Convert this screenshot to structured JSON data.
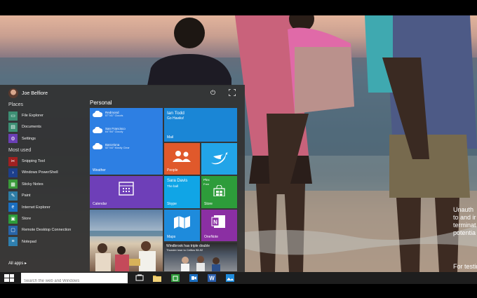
{
  "user": {
    "name": "Joe Belfiore"
  },
  "left": {
    "places_label": "Places",
    "places": [
      {
        "label": "File Explorer",
        "icon": "folder-icon",
        "color": "#3d8f74"
      },
      {
        "label": "Documents",
        "icon": "documents-icon",
        "color": "#3d8f74"
      },
      {
        "label": "Settings",
        "icon": "gear-icon",
        "color": "#6a3fb5"
      }
    ],
    "most_used_label": "Most used",
    "most_used": [
      {
        "label": "Snipping Tool",
        "icon": "scissors-icon",
        "color": "#a02020"
      },
      {
        "label": "Windows PowerShell",
        "icon": "powershell-icon",
        "color": "#1d3f8c"
      },
      {
        "label": "Sticky Notes",
        "icon": "sticky-notes-icon",
        "color": "#3a9a3a"
      },
      {
        "label": "Paint",
        "icon": "paint-icon",
        "color": "#2e7da6"
      },
      {
        "label": "Internet Explorer",
        "icon": "internet-explorer-icon",
        "color": "#1a6ec0"
      },
      {
        "label": "Store",
        "icon": "store-icon",
        "color": "#2d9c3a"
      },
      {
        "label": "Remote Desktop Connection",
        "icon": "remote-desktop-icon",
        "color": "#2864a8"
      },
      {
        "label": "Notepad",
        "icon": "notepad-icon",
        "color": "#2f7fae"
      }
    ],
    "all_apps": "All apps ▸"
  },
  "personal_label": "Personal",
  "tiles": {
    "weather": {
      "name": "Weather",
      "rows": [
        {
          "city": "Redmond",
          "desc": "57°/41° Clouds"
        },
        {
          "city": "San Francisco",
          "desc": "64°/54° Cloudy"
        },
        {
          "city": "Barcelona",
          "desc": "52°/44° Mostly Clear"
        }
      ]
    },
    "mail": {
      "name": "Mail",
      "from": "Ian Todd",
      "subject": "Go Hawks!"
    },
    "people": {
      "name": "People"
    },
    "twitter": {
      "name": ""
    },
    "calendar": {
      "name": "Calendar"
    },
    "skype": {
      "name": "Skype",
      "contact": "Sara Davis",
      "message": "The ball"
    },
    "store": {
      "name": "Store",
      "caption": "Plex",
      "sub": "Free"
    },
    "maps": {
      "name": "Maps"
    },
    "onenote": {
      "name": "OneNote"
    },
    "news": {
      "headline": "Windbrook has triple double",
      "sub": "Thunder lose to Celtics 98-92"
    }
  },
  "taskbar": {
    "search_placeholder": "Search the web and Windows"
  },
  "wallpaper_text": {
    "lines": [
      "Unauth",
      "to and ir",
      "terminat",
      "potentia"
    ],
    "bottom": "For testin"
  },
  "colors": {
    "tile_blue": "#2d7fe3",
    "mail_blue": "#1a86d6",
    "people_orange": "#e0592b",
    "twitter_blue": "#22a4e8",
    "calendar_purple": "#6e3fb8",
    "skype_blue": "#10a5e6",
    "store_green": "#2d9c3a",
    "maps_blue": "#1e8bdc",
    "onenote_purple": "#8b2fa3",
    "taskbar": "#1e1e1e"
  }
}
